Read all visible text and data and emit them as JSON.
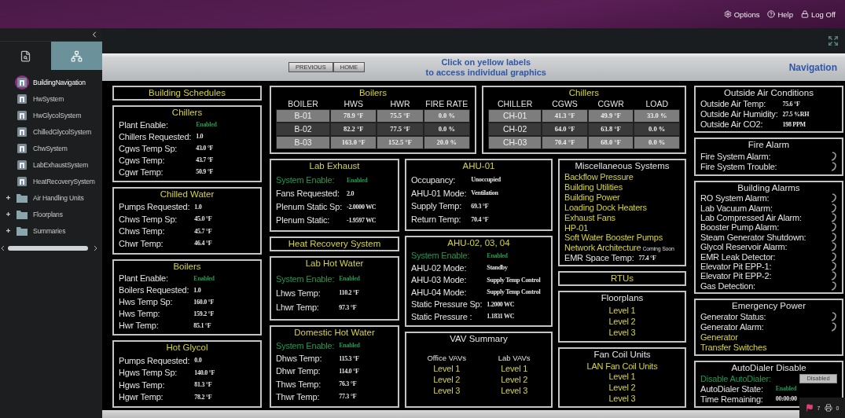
{
  "header": {
    "links": [
      {
        "kind": "options",
        "label": "Options"
      },
      {
        "kind": "help",
        "label": "Help"
      },
      {
        "kind": "logoff",
        "label": "Log Off"
      }
    ]
  },
  "sidebar": {
    "tabs": [
      {
        "kind": "search",
        "selected": false
      },
      {
        "kind": "tree",
        "selected": true
      }
    ],
    "items": [
      {
        "kind": "page",
        "label": "BuildingNavigation",
        "selected": true
      },
      {
        "kind": "page",
        "label": "HwSystem",
        "selected": false
      },
      {
        "kind": "page",
        "label": "HwGlycolSystem",
        "selected": false
      },
      {
        "kind": "page",
        "label": "ChilledGlycolSystem",
        "selected": false
      },
      {
        "kind": "page",
        "label": "ChwSystem",
        "selected": false
      },
      {
        "kind": "page",
        "label": "LabExhaustSystem",
        "selected": false
      },
      {
        "kind": "page",
        "label": "HeatRecoverySystem",
        "selected": false
      },
      {
        "kind": "folder",
        "label": "Air Handling Units",
        "selected": false,
        "expanded": false
      },
      {
        "kind": "folder",
        "label": "Floorplans",
        "selected": false,
        "expanded": false
      },
      {
        "kind": "folder",
        "label": "Summaries",
        "selected": false,
        "expanded": false
      }
    ]
  },
  "toolbar": {
    "buttons": [
      "PREVIOUS",
      "HOME"
    ],
    "hint_lines": [
      "Click on yellow labels",
      "to access individual graphics"
    ],
    "title": "Navigation"
  },
  "left_column": [
    {
      "kind": "link",
      "title": "Building Schedules"
    },
    {
      "kind": "list",
      "title": "Chillers",
      "title_link": true,
      "rows": [
        {
          "kind": "value",
          "label": "Plant Enable:",
          "value": "Enabled",
          "label_highlighted": false,
          "value_highlighted": true
        },
        {
          "kind": "value",
          "label": "Chillers Requested:",
          "value": "1.0",
          "label_highlighted": false,
          "value_highlighted": false
        },
        {
          "kind": "value",
          "label": "Cgws Temp Sp:",
          "value": "43.0 °F",
          "label_highlighted": false,
          "value_highlighted": false
        },
        {
          "kind": "value",
          "label": "Cgws Temp:",
          "value": "43.7 °F",
          "label_highlighted": false,
          "value_highlighted": false
        },
        {
          "kind": "value",
          "label": "Cgwr Temp:",
          "value": "50.9 °F",
          "label_highlighted": false,
          "value_highlighted": false
        }
      ]
    },
    {
      "kind": "list",
      "title": "Chilled Water",
      "title_link": true,
      "rows": [
        {
          "kind": "value",
          "label": "Pumps Requested:",
          "value": "1.0",
          "label_highlighted": false,
          "value_highlighted": false
        },
        {
          "kind": "value",
          "label": "Chws Temp Sp:",
          "value": "45.0 °F",
          "label_highlighted": false,
          "value_highlighted": false
        },
        {
          "kind": "value",
          "label": "Chws Temp:",
          "value": "45.7 °F",
          "label_highlighted": false,
          "value_highlighted": false
        },
        {
          "kind": "value",
          "label": "Chwr Temp:",
          "value": "46.4 °F",
          "label_highlighted": false,
          "value_highlighted": false
        }
      ]
    },
    {
      "kind": "list",
      "title": "Boilers",
      "title_link": true,
      "rows": [
        {
          "kind": "value",
          "label": "Plant Enable:",
          "value": "Enabled",
          "label_highlighted": false,
          "value_highlighted": true
        },
        {
          "kind": "value",
          "label": "Boilers Requested:",
          "value": "1.0",
          "label_highlighted": false,
          "value_highlighted": false
        },
        {
          "kind": "value",
          "label": "Hws Temp Sp:",
          "value": "160.0 °F",
          "label_highlighted": false,
          "value_highlighted": false
        },
        {
          "kind": "value",
          "label": "Hws Temp:",
          "value": "159.2 °F",
          "label_highlighted": false,
          "value_highlighted": false
        },
        {
          "kind": "value",
          "label": "Hwr Temp:",
          "value": "85.1 °F",
          "label_highlighted": false,
          "value_highlighted": false
        }
      ]
    },
    {
      "kind": "list",
      "title": "Hot Glycol",
      "title_link": true,
      "rows": [
        {
          "kind": "value",
          "label": "Pumps Requested:",
          "value": "0.0",
          "label_highlighted": false,
          "value_highlighted": false
        },
        {
          "kind": "value",
          "label": "Hgws Temp Sp:",
          "value": "140.0 °F",
          "label_highlighted": false,
          "value_highlighted": false
        },
        {
          "kind": "value",
          "label": "Hgws Temp:",
          "value": "81.3 °F",
          "label_highlighted": false,
          "value_highlighted": false
        },
        {
          "kind": "value",
          "label": "Hgwr Temp:",
          "value": "78.2 °F",
          "label_highlighted": false,
          "value_highlighted": false
        }
      ]
    }
  ],
  "center_tables": [
    {
      "kind": "table",
      "title": "Boilers",
      "columns": [
        "BOILER",
        "HWS",
        "HWR",
        "FIRE RATE"
      ],
      "rows": [
        [
          "B-01",
          "78.9 °F",
          "75.5 °F",
          "0.0 %"
        ],
        [
          "B-02",
          "82.2 °F",
          "77.5 °F",
          "0.0 %"
        ],
        [
          "B-03",
          "163.0 °F",
          "152.5 °F",
          "20.0 %"
        ]
      ]
    },
    {
      "kind": "table",
      "title": "Chillers",
      "columns": [
        "CHILLER",
        "CGWS",
        "CGWR",
        "LOAD"
      ],
      "rows": [
        [
          "CH-01",
          "41.3 °F",
          "49.9 °F",
          "33.0 %"
        ],
        [
          "CH-02",
          "64.0 °F",
          "63.8 °F",
          "0.0 %"
        ],
        [
          "CH-03",
          "70.4 °F",
          "68.0 °F",
          "0.0 %"
        ]
      ]
    }
  ],
  "center_columns": [
    [
      {
        "kind": "list",
        "title": "Lab Exhaust",
        "title_link": true,
        "rows": [
          {
            "kind": "value",
            "label": "System Enable:",
            "value": "Enabled",
            "label_highlighted": true,
            "value_highlighted": true
          },
          {
            "kind": "value",
            "label": "Fans Requested:",
            "value": "2.0",
            "label_highlighted": false,
            "value_highlighted": false
          },
          {
            "kind": "value",
            "label": "Plenum Static Sp:",
            "value": "-2.0000 WC",
            "label_highlighted": false,
            "value_highlighted": false
          },
          {
            "kind": "value",
            "label": "Plenum Static:",
            "value": "-1.9597 WC",
            "label_highlighted": false,
            "value_highlighted": false
          }
        ]
      },
      {
        "kind": "link",
        "title": "Heat Recovery System"
      },
      {
        "kind": "list",
        "title": "Lab Hot Water",
        "title_link": true,
        "rows": [
          {
            "kind": "value",
            "label": "System Enable:",
            "value": "Enabled",
            "label_highlighted": true,
            "value_highlighted": true
          },
          {
            "kind": "value",
            "label": "Lhws Temp:",
            "value": "110.2 °F",
            "label_highlighted": false,
            "value_highlighted": false
          },
          {
            "kind": "value",
            "label": "Lhwr Temp:",
            "value": "97.3 °F",
            "label_highlighted": false,
            "value_highlighted": false
          }
        ]
      },
      {
        "kind": "list",
        "title": "Domestic Hot Water",
        "title_link": true,
        "rows": [
          {
            "kind": "value",
            "label": "System Enable:",
            "value": "Enabled",
            "label_highlighted": true,
            "value_highlighted": true
          },
          {
            "kind": "value",
            "label": "Dhws Temp:",
            "value": "115.3 °F",
            "label_highlighted": false,
            "value_highlighted": false
          },
          {
            "kind": "value",
            "label": "Dhwr Temp:",
            "value": "114.0 °F",
            "label_highlighted": false,
            "value_highlighted": false
          },
          {
            "kind": "value",
            "label": "Thws Temp:",
            "value": "76.3 °F",
            "label_highlighted": false,
            "value_highlighted": false
          },
          {
            "kind": "value",
            "label": "Thwr Temp:",
            "value": "77.3 °F",
            "label_highlighted": false,
            "value_highlighted": false
          }
        ]
      }
    ],
    [
      {
        "kind": "list",
        "title": "AHU-01",
        "title_link": true,
        "rows": [
          {
            "kind": "value",
            "label": "Occupancy:",
            "value": "Unoccupied",
            "label_highlighted": false,
            "value_highlighted": false
          },
          {
            "kind": "value",
            "label": "AHU-01 Mode:",
            "value": "Ventilation",
            "label_highlighted": false,
            "value_highlighted": false
          },
          {
            "kind": "value",
            "label": "Supply Temp:",
            "value": "69.3 °F",
            "label_highlighted": false,
            "value_highlighted": false
          },
          {
            "kind": "value",
            "label": "Return Temp:",
            "value": "70.4 °F",
            "label_highlighted": false,
            "value_highlighted": false
          }
        ]
      },
      {
        "kind": "list",
        "title": "AHU-02, 03, 04",
        "title_link": true,
        "rows": [
          {
            "kind": "value",
            "label": "System Enable:",
            "value": "Enabled",
            "label_highlighted": true,
            "value_highlighted": true
          },
          {
            "kind": "value",
            "label": "AHU-02 Mode:",
            "value": "Standby",
            "label_highlighted": false,
            "value_highlighted": false
          },
          {
            "kind": "value",
            "label": "AHU-03 Mode:",
            "value": "Supply Temp Control",
            "label_highlighted": false,
            "value_highlighted": false
          },
          {
            "kind": "value",
            "label": "AHU-04 Mode:",
            "value": "Supply Temp Control",
            "label_highlighted": false,
            "value_highlighted": false
          },
          {
            "kind": "value",
            "label": "Static Pressure Sp:",
            "value": "1.2000 WC",
            "label_highlighted": false,
            "value_highlighted": false
          },
          {
            "kind": "value",
            "label": "Static Pressure :",
            "value": "1.1831 WC",
            "label_highlighted": false,
            "value_highlighted": false
          }
        ]
      },
      {
        "kind": "columns",
        "title": "VAV Summary",
        "title_link": false,
        "columns": [
          {
            "heading": "Office VAVs",
            "links": [
              "Level 1",
              "Level 2",
              "Level 3"
            ]
          },
          {
            "heading": "Lab VAVs",
            "links": [
              "Level 1",
              "Level 2",
              "Level 3"
            ]
          }
        ]
      }
    ],
    [
      {
        "kind": "list",
        "title": "Miscellaneous Systems",
        "title_link": false,
        "rows": [
          {
            "kind": "link",
            "label": "Backflow Pressure"
          },
          {
            "kind": "link",
            "label": "Building Utilities"
          },
          {
            "kind": "link",
            "label": "Building Power"
          },
          {
            "kind": "link",
            "label": "Loading Dock Heaters"
          },
          {
            "kind": "link",
            "label": "Exhaust Fans"
          },
          {
            "kind": "link",
            "label": "HP-01"
          },
          {
            "kind": "link",
            "label": "Soft Water Booster Pumps"
          },
          {
            "kind": "link",
            "label": "Network Architecture",
            "note": "Coming Soon"
          },
          {
            "kind": "value",
            "label": "EMR Space Temp:",
            "value": "77.4 °F",
            "label_highlighted": false,
            "value_highlighted": false
          }
        ]
      },
      {
        "kind": "link",
        "title": "RTUs"
      },
      {
        "kind": "list",
        "title": "Floorplans",
        "title_link": false,
        "rows": [
          {
            "kind": "link",
            "label": "Level 1"
          },
          {
            "kind": "link",
            "label": "Level 2"
          },
          {
            "kind": "link",
            "label": "Level 3"
          }
        ]
      },
      {
        "kind": "list",
        "title": "Fan Coil Units",
        "title_link": false,
        "rows": [
          {
            "kind": "link",
            "label": "LAN Fan Coil Units"
          },
          {
            "kind": "link",
            "label": "Level 1"
          },
          {
            "kind": "link",
            "label": "Level 2"
          },
          {
            "kind": "link",
            "label": "Level 3"
          }
        ]
      }
    ]
  ],
  "right_column": [
    {
      "kind": "list",
      "title": "Outside Air Conditions",
      "title_link": false,
      "rows": [
        {
          "kind": "value",
          "label": "Outside Air Temp:",
          "value": "75.6 °F",
          "label_highlighted": false,
          "value_highlighted": false
        },
        {
          "kind": "value",
          "label": "Outside Air Humidity:",
          "value": "27.5 %RH",
          "label_highlighted": false,
          "value_highlighted": false
        },
        {
          "kind": "value",
          "label": "Outside Air CO2:",
          "value": "198 PPM",
          "label_highlighted": false,
          "value_highlighted": false
        }
      ]
    },
    {
      "kind": "list",
      "title": "Fire Alarm",
      "title_link": false,
      "rows": [
        {
          "kind": "alarm",
          "label": "Fire System Alarm:"
        },
        {
          "kind": "alarm",
          "label": "Fire System Trouble:"
        }
      ]
    },
    {
      "kind": "list",
      "title": "Building Alarms",
      "title_link": false,
      "rows": [
        {
          "kind": "alarm",
          "label": "RO System Alarm:"
        },
        {
          "kind": "alarm",
          "label": "Lab Vacuum Alarm:"
        },
        {
          "kind": "alarm",
          "label": "Lab Compressed Air Alarm:"
        },
        {
          "kind": "alarm",
          "label": "Booster Pump Alarm:"
        },
        {
          "kind": "alarm",
          "label": "Steam Generator Shutdown:"
        },
        {
          "kind": "alarm",
          "label": "Glycol Reservoir Alarm:"
        },
        {
          "kind": "alarm",
          "label": "EMR Leak Detector:"
        },
        {
          "kind": "alarm",
          "label": "Elevator Pit EPP-1:"
        },
        {
          "kind": "alarm",
          "label": "Elevator Pit EPP-2:"
        },
        {
          "kind": "alarm",
          "label": "Gas Detection:"
        }
      ]
    },
    {
      "kind": "list",
      "title": "Emergency Power",
      "title_link": false,
      "rows": [
        {
          "kind": "alarm",
          "label": "Generator Status:"
        },
        {
          "kind": "alarm",
          "label": "Generator Alarm:"
        },
        {
          "kind": "link",
          "label": "Generator"
        },
        {
          "kind": "link",
          "label": "Transfer Switches"
        }
      ]
    },
    {
      "kind": "list",
      "title": "AutoDialer Disable",
      "title_link": false,
      "rows": [
        {
          "kind": "button",
          "label": "Disable AutoDialer:",
          "button": "Disabled",
          "label_highlighted": true
        },
        {
          "kind": "value",
          "label": "AutoDialer State:",
          "value": "Enabled",
          "label_highlighted": false,
          "value_highlighted": true
        },
        {
          "kind": "value",
          "label": "Time Remaining:",
          "value": "00:00:00",
          "label_highlighted": false,
          "value_highlighted": false
        }
      ]
    }
  ],
  "tray": {
    "alarms": "7",
    "prints": "0"
  }
}
